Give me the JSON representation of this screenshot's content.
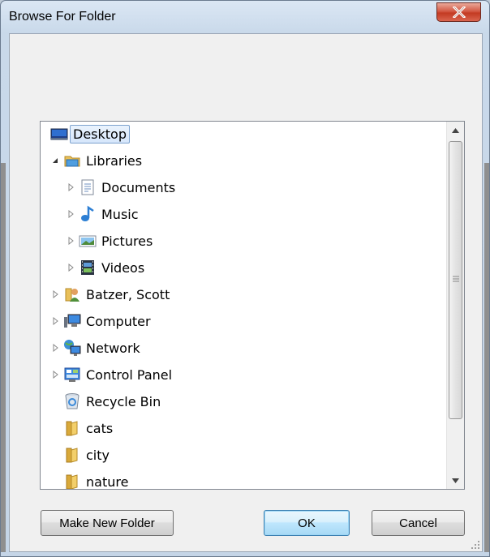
{
  "window": {
    "title": "Browse For Folder",
    "close_icon": "close-icon"
  },
  "tree": {
    "items": [
      {
        "label": "Desktop",
        "icon": "desktop-icon",
        "expander": "none",
        "selected": true
      },
      {
        "label": "Libraries",
        "icon": "libraries-icon",
        "expander": "expanded"
      },
      {
        "label": "Documents",
        "icon": "documents-icon",
        "expander": "collapsed"
      },
      {
        "label": "Music",
        "icon": "music-icon",
        "expander": "collapsed"
      },
      {
        "label": "Pictures",
        "icon": "pictures-icon",
        "expander": "collapsed"
      },
      {
        "label": "Videos",
        "icon": "videos-icon",
        "expander": "collapsed"
      },
      {
        "label": "Batzer, Scott",
        "icon": "user-folder-icon",
        "expander": "collapsed"
      },
      {
        "label": "Computer",
        "icon": "computer-icon",
        "expander": "collapsed"
      },
      {
        "label": "Network",
        "icon": "network-icon",
        "expander": "collapsed"
      },
      {
        "label": "Control Panel",
        "icon": "control-panel-icon",
        "expander": "collapsed"
      },
      {
        "label": "Recycle Bin",
        "icon": "recycle-bin-icon",
        "expander": "none"
      },
      {
        "label": "cats",
        "icon": "folder-icon",
        "expander": "none"
      },
      {
        "label": "city",
        "icon": "folder-icon",
        "expander": "none"
      },
      {
        "label": "nature",
        "icon": "folder-icon",
        "expander": "none"
      }
    ]
  },
  "buttons": {
    "make_new_folder": "Make New Folder",
    "ok": "OK",
    "cancel": "Cancel"
  },
  "colors": {
    "selection_border": "#7da2ce",
    "default_button_border": "#3c7fb1",
    "close_button": "#c33a22"
  }
}
